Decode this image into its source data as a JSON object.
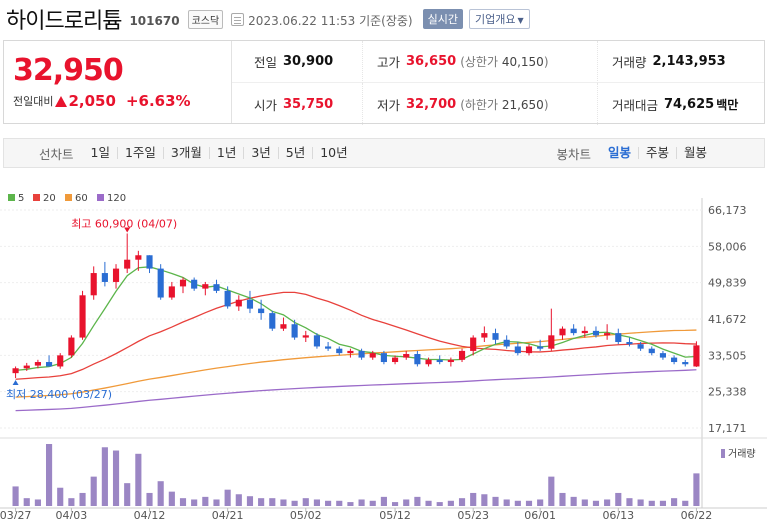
{
  "header": {
    "name": "하이드로리튬",
    "code": "101670",
    "market": "코스닥",
    "datetime": "2023.06.22 11:53 기준(장중)",
    "realtime_label": "실시간",
    "company_info_label": "기업개요"
  },
  "quote": {
    "price": "32,950",
    "change_label": "전일대비",
    "change": "2,050",
    "change_rate": "+6.63%",
    "prev_close_label": "전일",
    "prev_close": "30,900",
    "high_label": "고가",
    "high": "36,650",
    "upper_limit_label": "상한가",
    "upper_limit": "40,150",
    "volume_label": "거래량",
    "volume": "2,143,953",
    "open_label": "시가",
    "open": "35,750",
    "low_label": "저가",
    "low": "32,700",
    "lower_limit_label": "하한가",
    "lower_limit": "21,650",
    "amount_label": "거래대금",
    "amount": "74,625",
    "amount_unit": "백만"
  },
  "toolbar": {
    "line_label": "선차트",
    "line_periods": [
      "1일",
      "1주일",
      "3개월",
      "1년",
      "3년",
      "5년",
      "10년"
    ],
    "candle_label": "봉차트",
    "candle_periods": [
      "일봉",
      "주봉",
      "월봉"
    ],
    "active_candle": "일봉"
  },
  "colors": {
    "up": "#e8132d",
    "down": "#2a6dd3",
    "ma5": "#5cb54b",
    "ma20": "#e8413c",
    "ma60": "#f09a3a",
    "ma120": "#9b6bc9"
  },
  "chart_data": {
    "type": "candlestick",
    "legend": [
      "5",
      "20",
      "60",
      "120"
    ],
    "y_ticks": [
      66173,
      58006,
      49839,
      41672,
      33505,
      25338,
      17171
    ],
    "y_tick_labels": [
      "66,173",
      "58,006",
      "49,839",
      "41,672",
      "33,505",
      "25,338",
      "17,171"
    ],
    "x_labels": [
      {
        "label": "03/27",
        "index": 0
      },
      {
        "label": "04/03",
        "index": 5
      },
      {
        "label": "04/12",
        "index": 12
      },
      {
        "label": "04/21",
        "index": 19
      },
      {
        "label": "05/02",
        "index": 26
      },
      {
        "label": "05/12",
        "index": 34
      },
      {
        "label": "05/23",
        "index": 41
      },
      {
        "label": "06/01",
        "index": 47
      },
      {
        "label": "06/13",
        "index": 54
      },
      {
        "label": "06/22",
        "index": 61
      }
    ],
    "annotation_high": "최고 60,900 (04/07)",
    "annotation_low": "최저 28,400 (03/27)",
    "volume_label": "거래량",
    "ohlc": [
      [
        29500,
        31000,
        28400,
        30600
      ],
      [
        30600,
        31800,
        30000,
        31200
      ],
      [
        31200,
        32500,
        30600,
        32000
      ],
      [
        32000,
        33500,
        31500,
        31000
      ],
      [
        31000,
        34000,
        30500,
        33500
      ],
      [
        33500,
        38000,
        33000,
        37500
      ],
      [
        37500,
        48000,
        37000,
        47000
      ],
      [
        47000,
        53500,
        46000,
        52000
      ],
      [
        52000,
        54500,
        49000,
        50000
      ],
      [
        50000,
        54000,
        48500,
        53000
      ],
      [
        53000,
        60900,
        52000,
        55000
      ],
      [
        55000,
        57000,
        52500,
        56000
      ],
      [
        56000,
        56000,
        52000,
        53000
      ],
      [
        53000,
        54000,
        46000,
        46500
      ],
      [
        46500,
        50000,
        46000,
        49000
      ],
      [
        49000,
        51000,
        47500,
        50500
      ],
      [
        50500,
        51000,
        48000,
        48500
      ],
      [
        48500,
        50000,
        47000,
        49500
      ],
      [
        49500,
        50500,
        47500,
        48000
      ],
      [
        48000,
        49000,
        44000,
        44500
      ],
      [
        44500,
        47000,
        43500,
        46000
      ],
      [
        46000,
        48000,
        43000,
        44000
      ],
      [
        44000,
        46000,
        41500,
        43000
      ],
      [
        43000,
        43500,
        39000,
        39500
      ],
      [
        39500,
        42000,
        39000,
        40500
      ],
      [
        40500,
        41500,
        37000,
        37500
      ],
      [
        37500,
        39000,
        36500,
        38000
      ],
      [
        38000,
        38500,
        35000,
        35500
      ],
      [
        35500,
        36500,
        34500,
        35000
      ],
      [
        35000,
        35500,
        33500,
        34000
      ],
      [
        34000,
        35000,
        33000,
        34500
      ],
      [
        34500,
        35000,
        32500,
        33000
      ],
      [
        33000,
        34500,
        32500,
        34000
      ],
      [
        34000,
        34500,
        31500,
        32000
      ],
      [
        32000,
        33500,
        31500,
        33000
      ],
      [
        33000,
        34500,
        32500,
        33800
      ],
      [
        33800,
        34500,
        31000,
        31500
      ],
      [
        31500,
        33000,
        31000,
        32500
      ],
      [
        32500,
        33500,
        31500,
        32000
      ],
      [
        32000,
        33000,
        31000,
        32500
      ],
      [
        32500,
        35000,
        32000,
        34500
      ],
      [
        34500,
        38000,
        33500,
        37500
      ],
      [
        37500,
        40000,
        36500,
        38500
      ],
      [
        38500,
        39500,
        36000,
        37000
      ],
      [
        37000,
        38000,
        35000,
        35500
      ],
      [
        35500,
        36500,
        33500,
        34000
      ],
      [
        34000,
        36000,
        33500,
        35500
      ],
      [
        35500,
        37000,
        34500,
        35000
      ],
      [
        35000,
        44000,
        34500,
        38000
      ],
      [
        38000,
        40000,
        37000,
        39500
      ],
      [
        39500,
        40500,
        38000,
        38500
      ],
      [
        38500,
        40000,
        37500,
        39000
      ],
      [
        39000,
        40000,
        37500,
        38000
      ],
      [
        38000,
        40500,
        37000,
        38500
      ],
      [
        38500,
        39500,
        36000,
        36500
      ],
      [
        36500,
        37500,
        35500,
        36000
      ],
      [
        36000,
        36500,
        34500,
        35000
      ],
      [
        35000,
        35500,
        33500,
        34000
      ],
      [
        34000,
        34500,
        32500,
        33000
      ],
      [
        33000,
        33500,
        31500,
        32000
      ],
      [
        32000,
        32500,
        31000,
        31500
      ],
      [
        31000,
        36650,
        30900,
        35750
      ]
    ],
    "volume": [
      30,
      12,
      10,
      95,
      28,
      12,
      20,
      45,
      90,
      85,
      35,
      80,
      20,
      38,
      22,
      12,
      10,
      14,
      10,
      25,
      18,
      15,
      12,
      12,
      10,
      8,
      12,
      10,
      8,
      8,
      6,
      10,
      8,
      14,
      6,
      10,
      14,
      8,
      6,
      8,
      12,
      20,
      18,
      14,
      10,
      8,
      8,
      10,
      45,
      20,
      14,
      10,
      8,
      10,
      20,
      12,
      10,
      8,
      8,
      12,
      8,
      50
    ]
  }
}
